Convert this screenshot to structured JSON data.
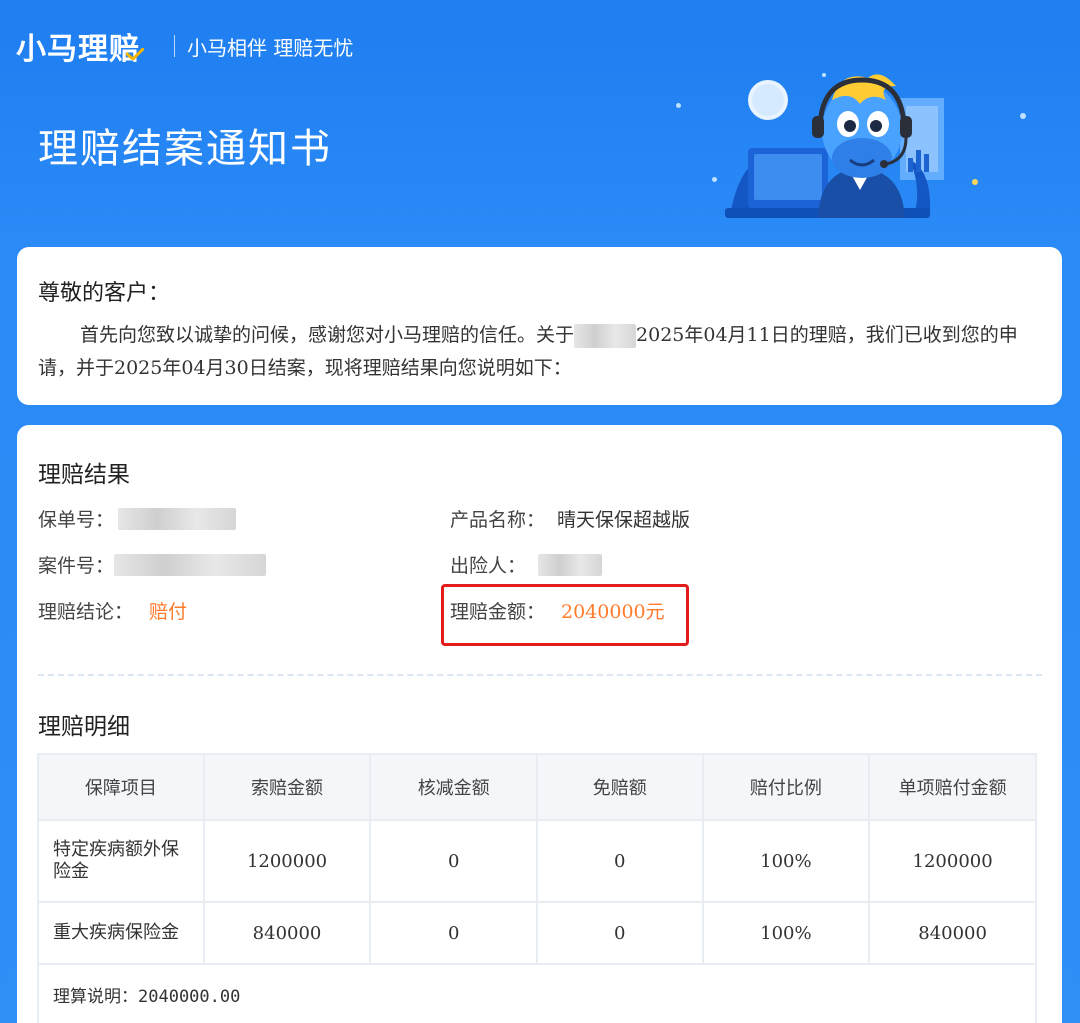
{
  "header": {
    "brand": "小马理赔",
    "slogan": "小马相伴 理赔无忧",
    "title": "理赔结案通知书"
  },
  "greeting": {
    "salutation": "尊敬的客户：",
    "body_part1": "首先向您致以诚挚的问候，感谢您对小马理赔的信任。关于",
    "body_part2": "2025年04月11日的理赔，我们已收到您的申请，并于2025年04月30日结案，现将理赔结果向您说明如下："
  },
  "result": {
    "title": "理赔结果",
    "policy_no_label": "保单号：",
    "product_label": "产品名称：",
    "product_value": "晴天保保超越版",
    "case_no_label": "案件号：",
    "insured_label": "出险人：",
    "conclusion_label": "理赔结论：",
    "conclusion_value": "赔付",
    "amount_label": "理赔金额：",
    "amount_value": "2040000元"
  },
  "detail": {
    "title": "理赔明细",
    "columns": [
      "保障项目",
      "索赔金额",
      "核减金额",
      "免赔额",
      "赔付比例",
      "单项赔付金额"
    ],
    "rows": [
      [
        "特定疾病额外保险金",
        "1200000",
        "0",
        "0",
        "100%",
        "1200000"
      ],
      [
        "重大疾病保险金",
        "840000",
        "0",
        "0",
        "100%",
        "840000"
      ]
    ],
    "note_label": "理算说明：",
    "note_value": "2040000.00"
  },
  "colors": {
    "background": "#2a8af6",
    "highlight": "#ff7a2b",
    "annotation_box": "#e31b1b"
  }
}
